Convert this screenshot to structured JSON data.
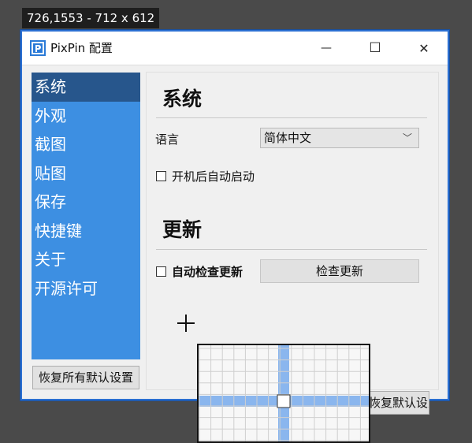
{
  "capture_readout": "726,1553 - 712 x 612",
  "window": {
    "title": "PixPin 配置",
    "controls": {
      "minimize": "—",
      "maximize": "☐",
      "close": "✕"
    }
  },
  "sidebar": {
    "items": [
      {
        "label": "系统",
        "active": true
      },
      {
        "label": "外观"
      },
      {
        "label": "截图"
      },
      {
        "label": "贴图"
      },
      {
        "label": "保存"
      },
      {
        "label": "快捷键"
      },
      {
        "label": "关于"
      },
      {
        "label": "开源许可"
      }
    ],
    "reset_all_label": "恢复所有默认设置"
  },
  "system_section": {
    "title": "系统",
    "language_label": "语言",
    "language_value": "简体中文",
    "autostart_label": "开机后自动启动",
    "autostart_checked": false
  },
  "update_section": {
    "title": "更新",
    "auto_check_label": "自动检查更新",
    "auto_check_checked": false,
    "check_button_label": "检查更新"
  },
  "reset_defaults_label": "恢复默认设置",
  "colors": {
    "sidebar_bg": "#3d8fe2",
    "sidebar_active_bg": "#27568c",
    "window_border": "#2b6fd1",
    "magnifier_crosshair": "#8ab6ee"
  }
}
